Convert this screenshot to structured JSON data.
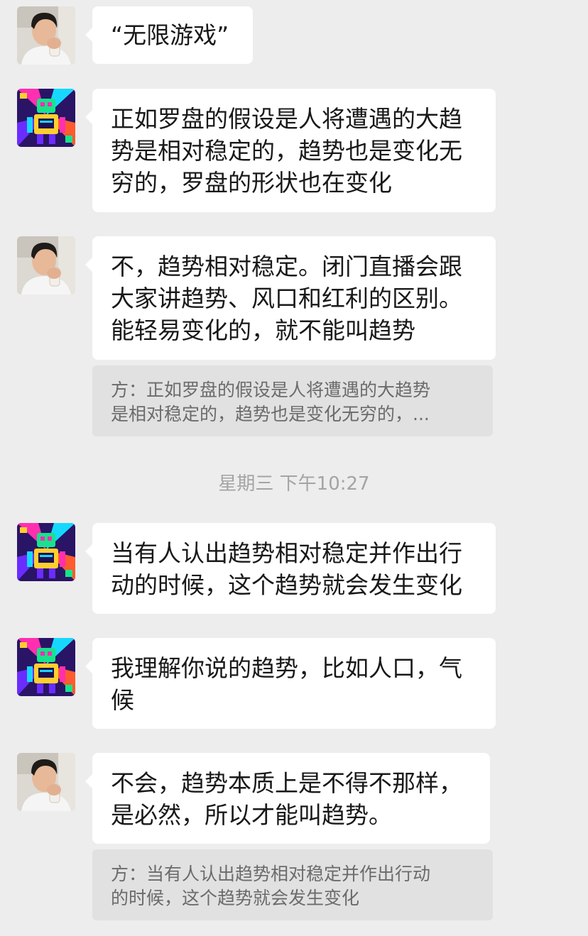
{
  "messages": [
    {
      "sender": "a",
      "text": "“无限游戏”"
    },
    {
      "sender": "b",
      "text": "正如罗盘的假设是人将遭遇的大趋\n势是相对稳定的，趋势也是变化无\n穷的，罗盘的形状也在变化"
    },
    {
      "sender": "a",
      "text": "不，趋势相对稳定。闭门直播会跟\n大家讲趋势、风口和红利的区别。\n能轻易变化的，就不能叫趋势"
    },
    {
      "quote": "方：正如罗盘的假设是人将遭遇的大趋势\n是相对稳定的，趋势也是变化无穷的，..."
    },
    {
      "sender": "b",
      "text": "当有人认出趋势相对稳定并作出行\n动的时候，这个趋势就会发生变化"
    },
    {
      "sender": "b",
      "text": "我理解你说的趋势，比如人口，气\n候"
    },
    {
      "sender": "a",
      "text": "不会，趋势本质上是不得不那样，\n是必然，所以才能叫趋势。"
    },
    {
      "quote": "方：当有人认出趋势相对稳定并作出行动\n的时候，这个趋势就会发生变化"
    }
  ],
  "timestamp": "星期三 下午10:27",
  "colors": {
    "background": "#ededed",
    "bubble": "#ffffff",
    "quote_bg": "#e1e1e1",
    "text": "#191919",
    "quote_text": "#6b6b6b",
    "timestamp": "#a4a4a4"
  },
  "icons": {
    "avatar_a": "man-drinking-portrait",
    "avatar_b": "robot-illustration-avatar"
  }
}
